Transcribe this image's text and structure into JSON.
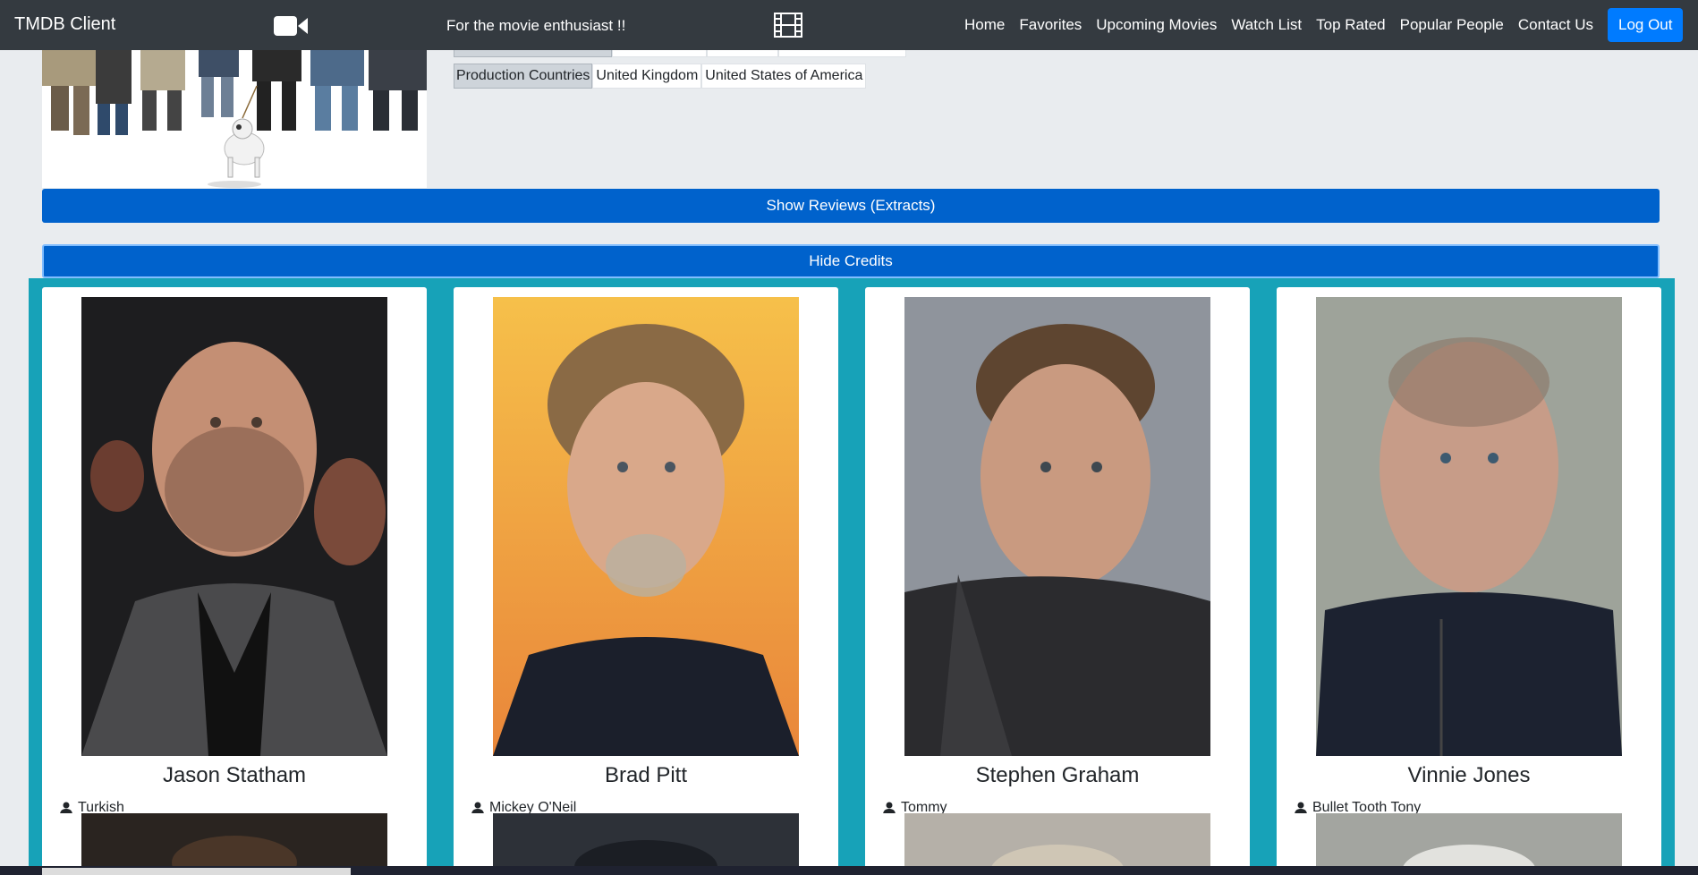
{
  "navbar": {
    "brand": "TMDB Client",
    "tagline": "For the movie enthusiast !!",
    "links": [
      "Home",
      "Favorites",
      "Upcoming Movies",
      "Watch List",
      "Top Rated",
      "Popular People",
      "Contact Us"
    ],
    "logout_label": "Log Out",
    "camera_icon": "video-camera-icon",
    "film_icon": "film-icon"
  },
  "details": {
    "production_countries_label": "Production Countries",
    "production_countries": [
      "United Kingdom",
      "United States of America"
    ]
  },
  "buttons": {
    "show_reviews": "Show Reviews (Extracts)",
    "hide_credits": "Hide Credits"
  },
  "credits": [
    {
      "name": "Jason Statham",
      "character": "Turkish"
    },
    {
      "name": "Brad Pitt",
      "character": "Mickey O'Neil"
    },
    {
      "name": "Stephen Graham",
      "character": "Tommy"
    },
    {
      "name": "Vinnie Jones",
      "character": "Bullet Tooth Tony"
    }
  ],
  "colors": {
    "navbar_bg": "#343a40",
    "primary": "#0062cc",
    "credits_bg": "#17a2b8",
    "page_bg": "#e9ecef"
  }
}
